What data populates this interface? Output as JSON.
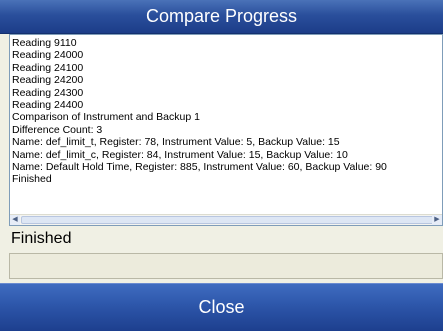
{
  "window": {
    "title": "Compare Progress"
  },
  "log": {
    "lines": [
      "Reading 9110",
      "Reading 24000",
      "Reading 24100",
      "Reading 24200",
      "Reading 24300",
      "Reading 24400",
      "Comparison of Instrument and Backup 1",
      "Difference Count: 3",
      "Name: def_limit_t, Register: 78, Instrument Value: 5, Backup Value: 15",
      "Name: def_limit_c, Register: 84, Instrument Value: 15, Backup Value: 10",
      "Name: Default Hold Time, Register: 885, Instrument Value: 60, Backup Value: 90",
      "Finished"
    ]
  },
  "status": {
    "label": "Finished",
    "field_value": ""
  },
  "buttons": {
    "close_label": "Close"
  },
  "icons": {
    "scroll_left": "scroll-left-arrow-icon",
    "scroll_right": "scroll-right-arrow-icon"
  },
  "colors": {
    "title_bar": "#2a4f9c",
    "close_button": "#2d56aa",
    "background": "#f0f0e4"
  }
}
